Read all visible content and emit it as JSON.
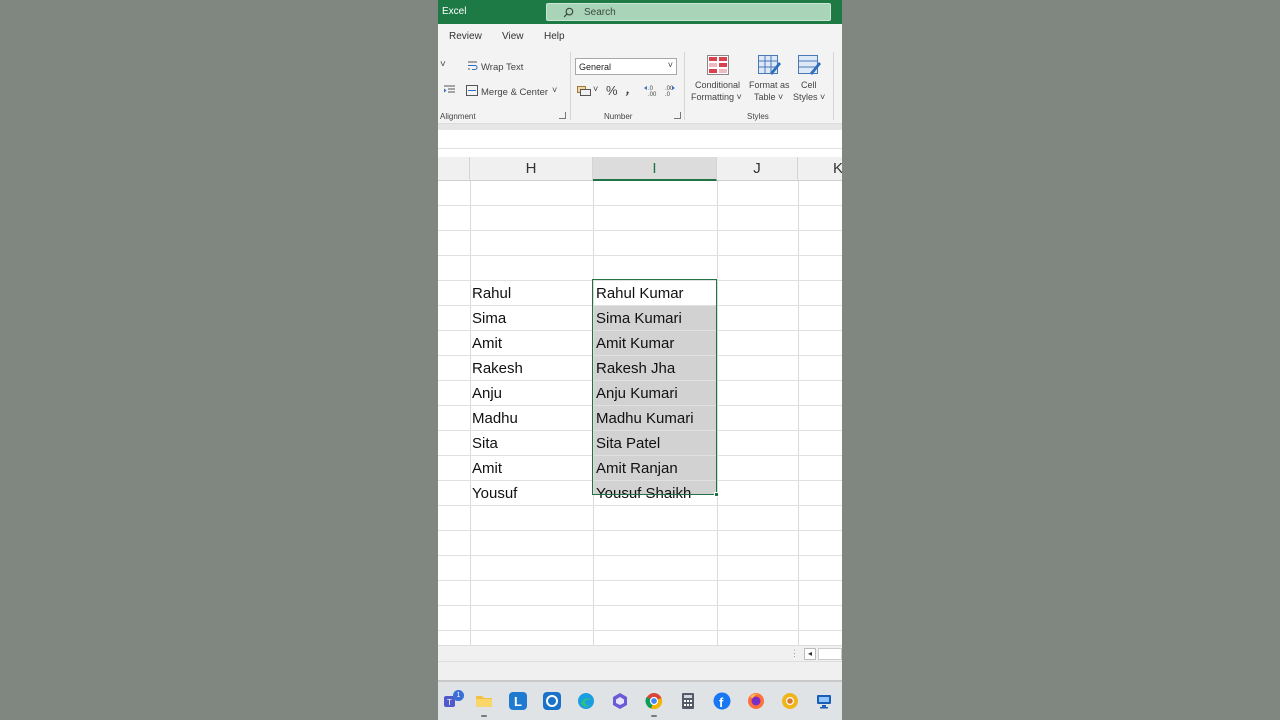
{
  "titlebar": {
    "app_name": "Excel",
    "search_placeholder": "Search"
  },
  "tabs": [
    "Review",
    "View",
    "Help"
  ],
  "ribbon": {
    "alignment": {
      "wrap_text": "Wrap Text",
      "merge_center": "Merge & Center",
      "group_label": "Alignment"
    },
    "number": {
      "format_value": "General",
      "percent": "%",
      "comma": ")",
      "group_label": "Number"
    },
    "styles": {
      "conditional_formatting": [
        "Conditional",
        "Formatting ˅"
      ],
      "format_as_table": [
        "Format as",
        "Table ˅"
      ],
      "cell_styles": [
        "Cell",
        "Styles ˅"
      ],
      "group_label": "Styles"
    }
  },
  "grid": {
    "columns": [
      "H",
      "I",
      "J",
      "K"
    ],
    "selected_column": "I",
    "rows": [
      {
        "h": "",
        "i": ""
      },
      {
        "h": "",
        "i": ""
      },
      {
        "h": "",
        "i": ""
      },
      {
        "h": "",
        "i": ""
      },
      {
        "h": "Rahul",
        "i": "Rahul Kumar"
      },
      {
        "h": "Sima",
        "i": "Sima Kumari"
      },
      {
        "h": "Amit",
        "i": "Amit Kumar"
      },
      {
        "h": "Rakesh",
        "i": "Rakesh Jha"
      },
      {
        "h": "Anju",
        "i": "Anju Kumari"
      },
      {
        "h": "Madhu",
        "i": "Madhu Kumari"
      },
      {
        "h": "Sita",
        "i": "Sita Patel"
      },
      {
        "h": "Amit",
        "i": "Amit Ranjan"
      },
      {
        "h": "Yousuf",
        "i": "Yousuf Shaikh"
      }
    ]
  },
  "taskbar": {
    "teams_badge": "1",
    "icons": [
      "teams-icon",
      "file-explorer-icon",
      "l-app-icon",
      "cortana-icon",
      "edge-icon",
      "copilot-icon",
      "chrome-icon",
      "calculator-icon",
      "facebook-icon",
      "firefox-icon",
      "chrome-canary-icon",
      "remote-desktop-icon"
    ]
  },
  "colors": {
    "accent": "#217346",
    "titlebar": "#1d7a45",
    "selection": "#d2d2d2"
  }
}
